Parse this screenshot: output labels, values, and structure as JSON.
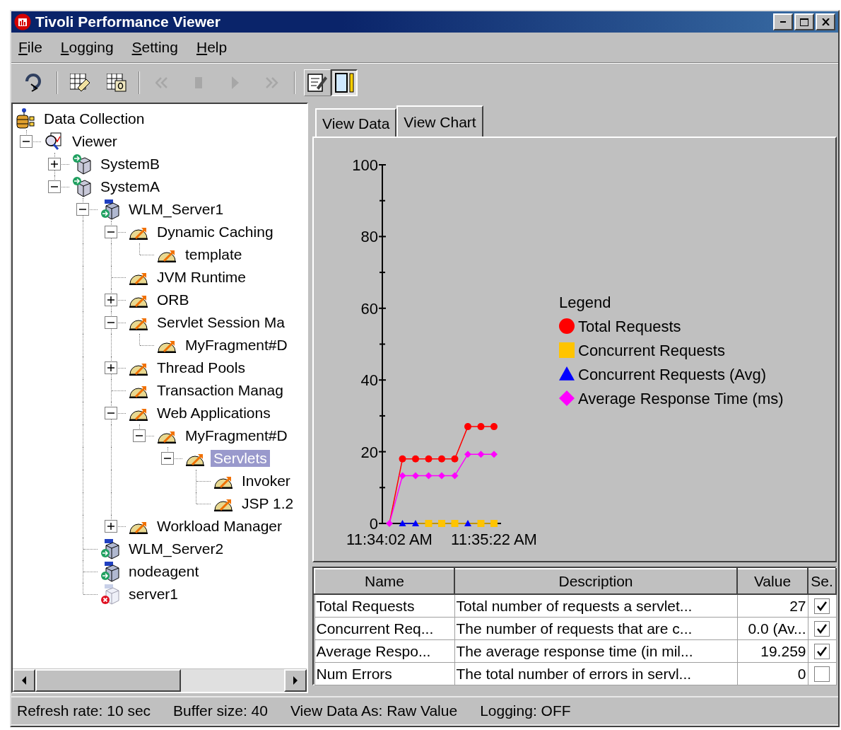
{
  "window": {
    "title": "Tivoli Performance Viewer"
  },
  "menu": [
    "File",
    "Logging",
    "Setting",
    "Help"
  ],
  "toolbar": [
    [
      {
        "kind": "button",
        "disabled": false
      }
    ],
    [
      {
        "kind": "button",
        "disabled": false
      },
      {
        "kind": "button",
        "disabled": false
      }
    ],
    [
      {
        "kind": "button",
        "disabled": true
      },
      {
        "kind": "button",
        "disabled": true
      },
      {
        "kind": "button",
        "disabled": true
      },
      {
        "kind": "button",
        "disabled": true
      }
    ],
    [
      {
        "kind": "toggle",
        "disabled": false,
        "selected": false
      },
      {
        "kind": "toggle",
        "disabled": false,
        "selected": true
      }
    ]
  ],
  "tree": [
    {
      "label": "Data Collection",
      "kind": "collection",
      "selected": false,
      "children": [
        {
          "label": "Viewer",
          "kind": "viewer",
          "selected": false,
          "expanded": true,
          "children": [
            {
              "label": "SystemB",
              "kind": "node",
              "selected": false,
              "expanded": false
            },
            {
              "label": "SystemA",
              "kind": "node",
              "selected": false,
              "expanded": true,
              "children": [
                {
                  "label": "WLM_Server1",
                  "kind": "server",
                  "selected": false,
                  "expanded": true,
                  "children": [
                    {
                      "label": "Dynamic Caching",
                      "kind": "module",
                      "selected": false,
                      "expanded": true,
                      "children": [
                        {
                          "label": "template",
                          "kind": "module",
                          "selected": false
                        }
                      ]
                    },
                    {
                      "label": "JVM Runtime",
                      "kind": "module",
                      "selected": false
                    },
                    {
                      "label": "ORB",
                      "kind": "module",
                      "selected": false,
                      "expanded": false
                    },
                    {
                      "label": "Servlet Session Ma",
                      "kind": "module",
                      "selected": false,
                      "expanded": true,
                      "children": [
                        {
                          "label": "MyFragment#D",
                          "kind": "module",
                          "selected": false
                        }
                      ]
                    },
                    {
                      "label": "Thread Pools",
                      "kind": "module",
                      "selected": false,
                      "expanded": false
                    },
                    {
                      "label": "Transaction Manag",
                      "kind": "module",
                      "selected": false
                    },
                    {
                      "label": "Web Applications",
                      "kind": "module",
                      "selected": false,
                      "expanded": true,
                      "children": [
                        {
                          "label": "MyFragment#D",
                          "kind": "module",
                          "selected": false,
                          "expanded": true,
                          "children": [
                            {
                              "label": "Servlets",
                              "kind": "module",
                              "selected": true,
                              "expanded": true,
                              "children": [
                                {
                                  "label": "Invoker",
                                  "kind": "module",
                                  "selected": false
                                },
                                {
                                  "label": "JSP 1.2",
                                  "kind": "module",
                                  "selected": false
                                }
                              ]
                            }
                          ]
                        }
                      ]
                    },
                    {
                      "label": "Workload Manager",
                      "kind": "module",
                      "selected": false,
                      "expanded": false
                    }
                  ]
                },
                {
                  "label": "WLM_Server2",
                  "kind": "server",
                  "selected": false
                },
                {
                  "label": "nodeagent",
                  "kind": "server",
                  "selected": false
                },
                {
                  "label": "server1",
                  "kind": "server_stopped",
                  "selected": false
                }
              ]
            }
          ]
        }
      ]
    }
  ],
  "tabs": [
    {
      "label": "View Data",
      "selected": false
    },
    {
      "label": "View Chart",
      "selected": true
    }
  ],
  "chart": {
    "legend_title": "Legend",
    "chart_data": {
      "type": "line",
      "categories": [
        "11:34:02 AM",
        null,
        null,
        null,
        null,
        null,
        null,
        null,
        "11:35:22 AM"
      ],
      "ylim": [
        0,
        100
      ],
      "yticks": [
        0,
        20,
        40,
        60,
        80,
        100
      ],
      "legend": true,
      "series": [
        {
          "name": "Total Requests",
          "color": "#ff0000",
          "marker": "circle",
          "values": [
            0,
            18,
            18,
            18,
            18,
            18,
            27,
            27,
            27
          ]
        },
        {
          "name": "Concurrent Requests",
          "color": "#ffc400",
          "marker": "square",
          "values": [
            null,
            null,
            0,
            0,
            0,
            0,
            0,
            0,
            0
          ]
        },
        {
          "name": "Concurrent Requests (Avg)",
          "color": "#0000ff",
          "marker": "triangle",
          "values": [
            null,
            0,
            0,
            null,
            null,
            null,
            0,
            null,
            null
          ]
        },
        {
          "name": "Average Response Time (ms)",
          "color": "#ff00ff",
          "marker": "diamond",
          "values": [
            0,
            13.3,
            13.3,
            13.3,
            13.3,
            13.3,
            19.3,
            19.3,
            19.3
          ]
        }
      ]
    }
  },
  "table": {
    "columns": [
      "Name",
      "Description",
      "Value",
      "Se."
    ],
    "rows": [
      {
        "cells": [
          "Total Requests",
          "Total number of requests a servlet...",
          "27"
        ],
        "checked": true
      },
      {
        "cells": [
          "Concurrent Req...",
          "The number of requests that are c...",
          "0.0 (Av..."
        ],
        "checked": true
      },
      {
        "cells": [
          "Average Respo...",
          "The average response time (in mil...",
          "19.259"
        ],
        "checked": true
      },
      {
        "cells": [
          "Num Errors",
          "The total number of errors in servl...",
          "0"
        ],
        "checked": false
      }
    ]
  },
  "status_bar": [
    "Refresh rate: 10 sec",
    "Buffer size: 40",
    "View Data As: Raw Value",
    "Logging: OFF"
  ]
}
